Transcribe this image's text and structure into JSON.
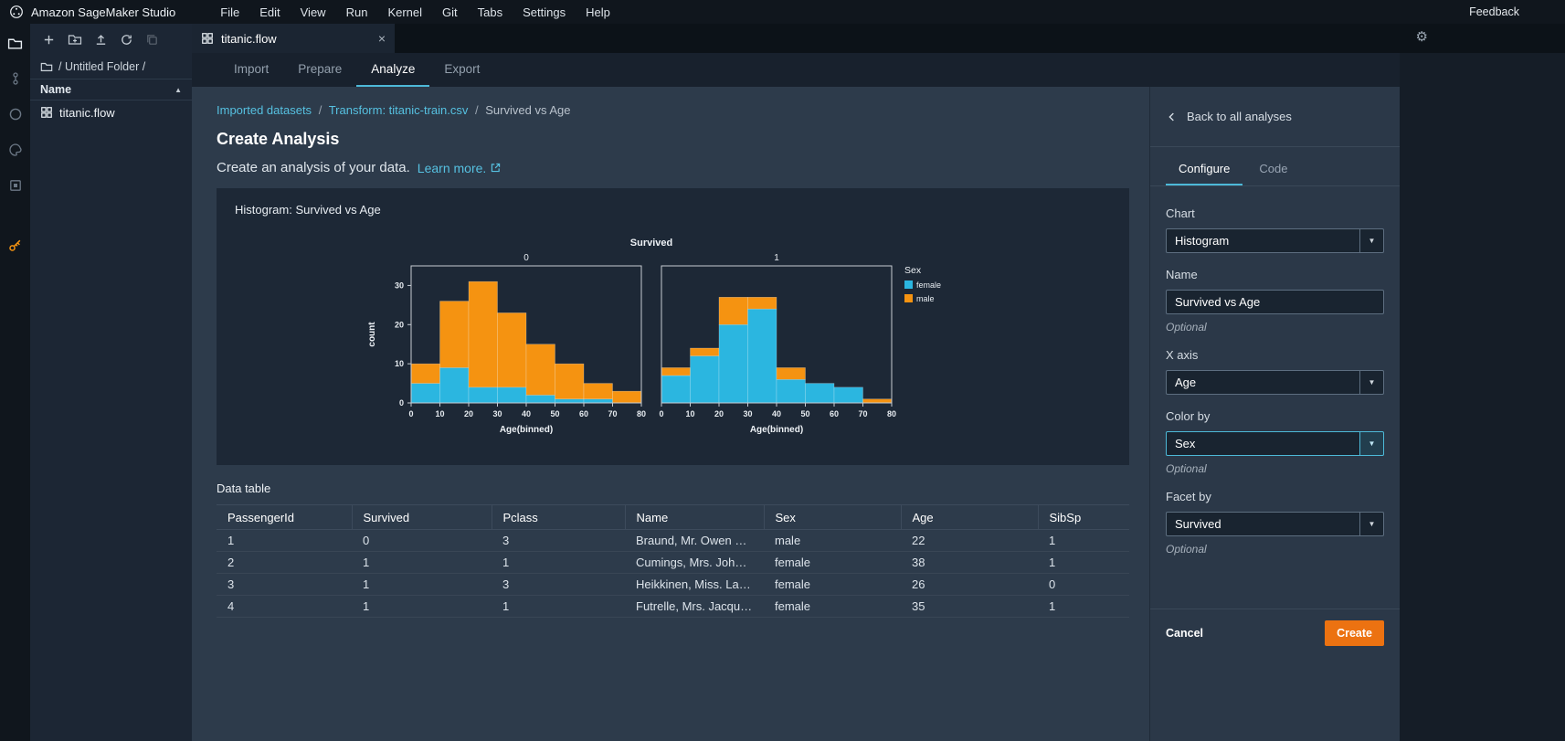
{
  "menubar": {
    "app_title": "Amazon SageMaker Studio",
    "items": [
      "File",
      "Edit",
      "View",
      "Run",
      "Kernel",
      "Git",
      "Tabs",
      "Settings",
      "Help"
    ],
    "feedback": "Feedback"
  },
  "file_browser": {
    "breadcrumb": "/ Untitled Folder /",
    "name_header": "Name",
    "files": [
      {
        "name": "titanic.flow"
      }
    ]
  },
  "tabbar": {
    "tabs": [
      {
        "label": "titanic.flow"
      }
    ]
  },
  "subnav": {
    "tabs": [
      "Import",
      "Prepare",
      "Analyze",
      "Export"
    ],
    "active": "Analyze"
  },
  "analyze": {
    "breadcrumb": [
      {
        "label": "Imported datasets"
      },
      {
        "label": "Transform: titanic-train.csv"
      },
      {
        "label": "Survived vs Age"
      }
    ],
    "breadcrumb_separator": "/",
    "title": "Create Analysis",
    "subtitle": "Create an analysis of your data.",
    "learn_more": "Learn more.",
    "chart_panel_title": "Histogram: Survived vs Age",
    "data_table_label": "Data table"
  },
  "table": {
    "columns": [
      "PassengerId",
      "Survived",
      "Pclass",
      "Name",
      "Sex",
      "Age",
      "SibSp"
    ],
    "rows": [
      [
        "1",
        "0",
        "3",
        "Braund, Mr. Owen Harris",
        "male",
        "22",
        "1"
      ],
      [
        "2",
        "1",
        "1",
        "Cumings, Mrs. John Bra…",
        "female",
        "38",
        "1"
      ],
      [
        "3",
        "1",
        "3",
        "Heikkinen, Miss. Laina",
        "female",
        "26",
        "0"
      ],
      [
        "4",
        "1",
        "1",
        "Futrelle, Mrs. Jacques H…",
        "female",
        "35",
        "1"
      ]
    ]
  },
  "config_panel": {
    "back_label": "Back to all analyses",
    "tabs": [
      "Configure",
      "Code"
    ],
    "active_tab": "Configure",
    "fields": {
      "chart": {
        "label": "Chart",
        "value": "Histogram"
      },
      "name": {
        "label": "Name",
        "value": "Survived vs Age",
        "note": "Optional"
      },
      "x_axis": {
        "label": "X axis",
        "value": "Age"
      },
      "color_by": {
        "label": "Color by",
        "value": "Sex",
        "note": "Optional"
      },
      "facet_by": {
        "label": "Facet by",
        "value": "Survived",
        "note": "Optional"
      }
    },
    "cancel_label": "Cancel",
    "create_label": "Create"
  },
  "colors": {
    "accent": "#4db9d8",
    "link": "#56c1e1",
    "create_orange": "#ec7211",
    "female": "#2bb6e0",
    "male": "#f59311"
  },
  "chart_data": {
    "type": "bar",
    "subtype": "faceted-stacked-histogram",
    "title": "Histogram: Survived vs Age",
    "facet_title": "Survived",
    "x_label": "Age(binned)",
    "y_label": "count",
    "bin_edges": [
      0,
      10,
      20,
      30,
      40,
      50,
      60,
      70,
      80
    ],
    "x_ticks": [
      0,
      10,
      20,
      30,
      40,
      50,
      60,
      70,
      80
    ],
    "y_ticks": [
      0,
      10,
      20,
      30
    ],
    "y_max": 35,
    "legend_title": "Sex",
    "series_order": [
      "female",
      "male"
    ],
    "series_colors": {
      "female": "#2bb6e0",
      "male": "#f59311"
    },
    "facets": [
      {
        "label": "0",
        "stacks": {
          "female": [
            5,
            9,
            4,
            4,
            2,
            1,
            1,
            0
          ],
          "male": [
            5,
            17,
            27,
            19,
            13,
            9,
            4,
            3
          ]
        }
      },
      {
        "label": "1",
        "stacks": {
          "female": [
            7,
            12,
            20,
            24,
            6,
            5,
            4,
            0
          ],
          "male": [
            2,
            2,
            7,
            3,
            3,
            0,
            0,
            1
          ]
        }
      }
    ]
  }
}
